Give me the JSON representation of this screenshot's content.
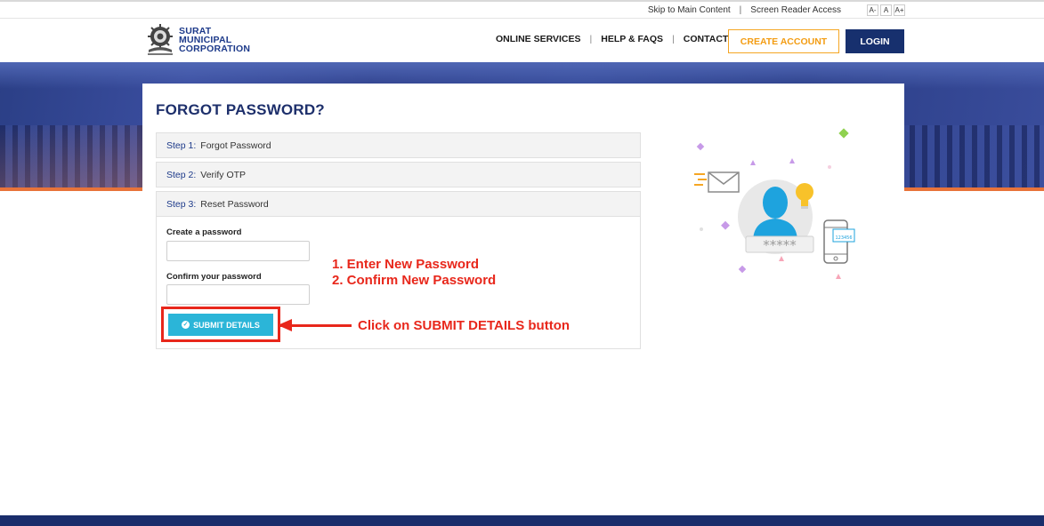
{
  "util": {
    "skip_link": "Skip to Main Content",
    "separator": "|",
    "screen_reader": "Screen Reader Access",
    "font_small": "A-",
    "font_normal": "A",
    "font_large": "A+"
  },
  "logo": {
    "line1": "SURAT",
    "line2": "MUNICIPAL",
    "line3": "CORPORATION"
  },
  "nav": {
    "online_services": "ONLINE SERVICES",
    "help_faqs": "HELP & FAQS",
    "contact": "CONTACT",
    "divider": "|",
    "create_account": "CREATE ACCOUNT",
    "login": "LOGIN"
  },
  "form": {
    "title": "FORGOT PASSWORD?",
    "steps": [
      {
        "num": "Step 1:",
        "label": "Forgot Password"
      },
      {
        "num": "Step 2:",
        "label": "Verify OTP"
      },
      {
        "num": "Step 3:",
        "label": "Reset Password"
      }
    ],
    "create_label": "Create a password",
    "confirm_label": "Confirm your password",
    "create_value": "",
    "confirm_value": "",
    "submit_label": "SUBMIT DETAILS"
  },
  "annotations": {
    "line1": "1. Enter New Password",
    "line2": "2. Confirm New Password",
    "click": "Click on SUBMIT DETAILS button"
  },
  "illustration": {
    "otp_text": "123456",
    "password_mask": "*****"
  },
  "colors": {
    "brand_navy": "#17306e",
    "accent_orange": "#f39c12",
    "submit_cyan": "#2bb5d8",
    "annotation_red": "#e8271b"
  }
}
